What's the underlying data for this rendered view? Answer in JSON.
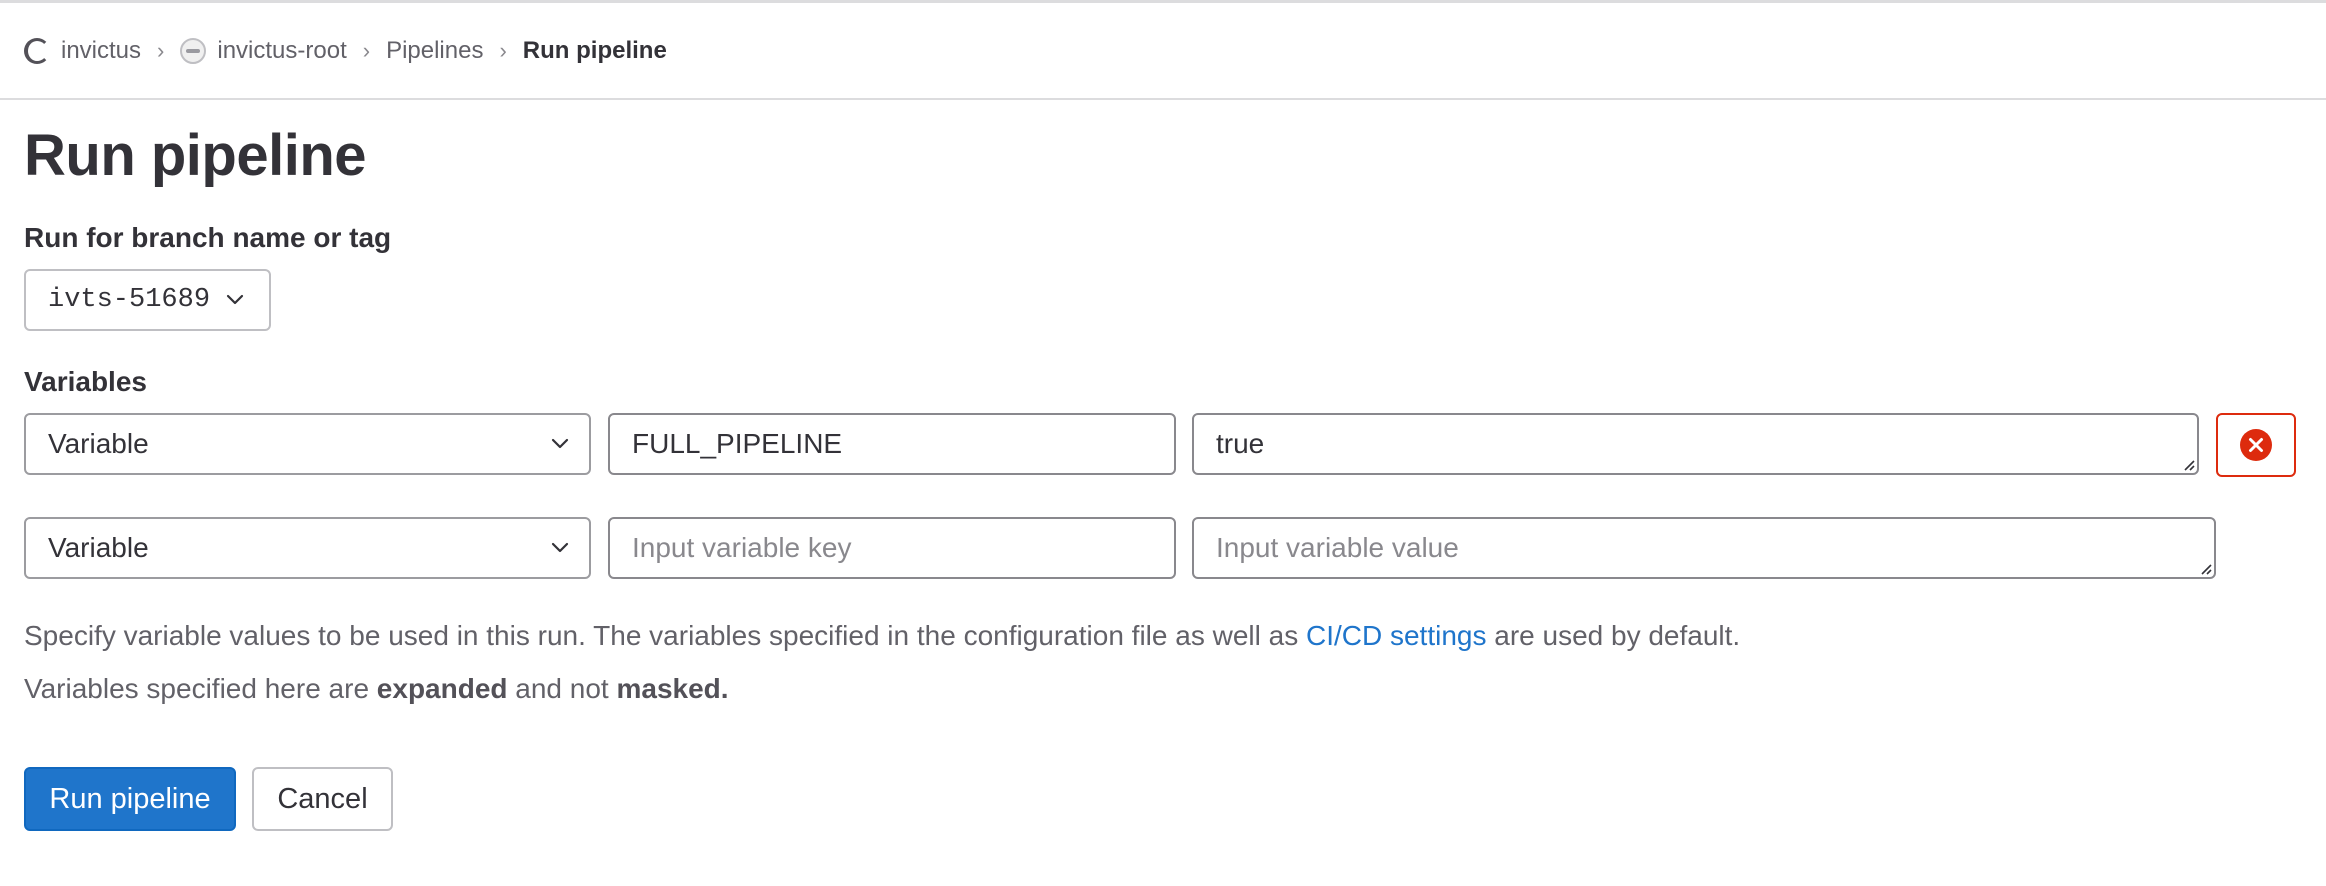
{
  "breadcrumb": {
    "items": [
      {
        "label": "invictus",
        "icon": "group-avatar-icon"
      },
      {
        "label": "invictus-root",
        "icon": "project-avatar-icon"
      },
      {
        "label": "Pipelines"
      },
      {
        "label": "Run pipeline"
      }
    ],
    "separator": "›"
  },
  "page": {
    "title": "Run pipeline"
  },
  "branch": {
    "label": "Run for branch name or tag",
    "selected": "ivts-51689"
  },
  "variables": {
    "label": "Variables",
    "rows": [
      {
        "type": "Variable",
        "key": "FULL_PIPELINE",
        "value": "true",
        "removable": true
      },
      {
        "type": "Variable",
        "key": "",
        "value": "",
        "key_placeholder": "Input variable key",
        "value_placeholder": "Input variable value",
        "removable": false
      }
    ]
  },
  "help": {
    "line1_prefix": "Specify variable values to be used in this run. The variables specified in the configuration file as well as ",
    "line1_link": "CI/CD settings",
    "line1_suffix": " are used by default.",
    "line2_prefix": "Variables specified here are ",
    "line2_bold1": "expanded",
    "line2_mid": " and not ",
    "line2_bold2": "masked."
  },
  "actions": {
    "run_label": "Run pipeline",
    "cancel_label": "Cancel"
  },
  "colors": {
    "primary": "#1f75cb",
    "danger": "#dd2b0e",
    "link": "#1f75cb",
    "text": "#333238",
    "muted": "#626168"
  }
}
